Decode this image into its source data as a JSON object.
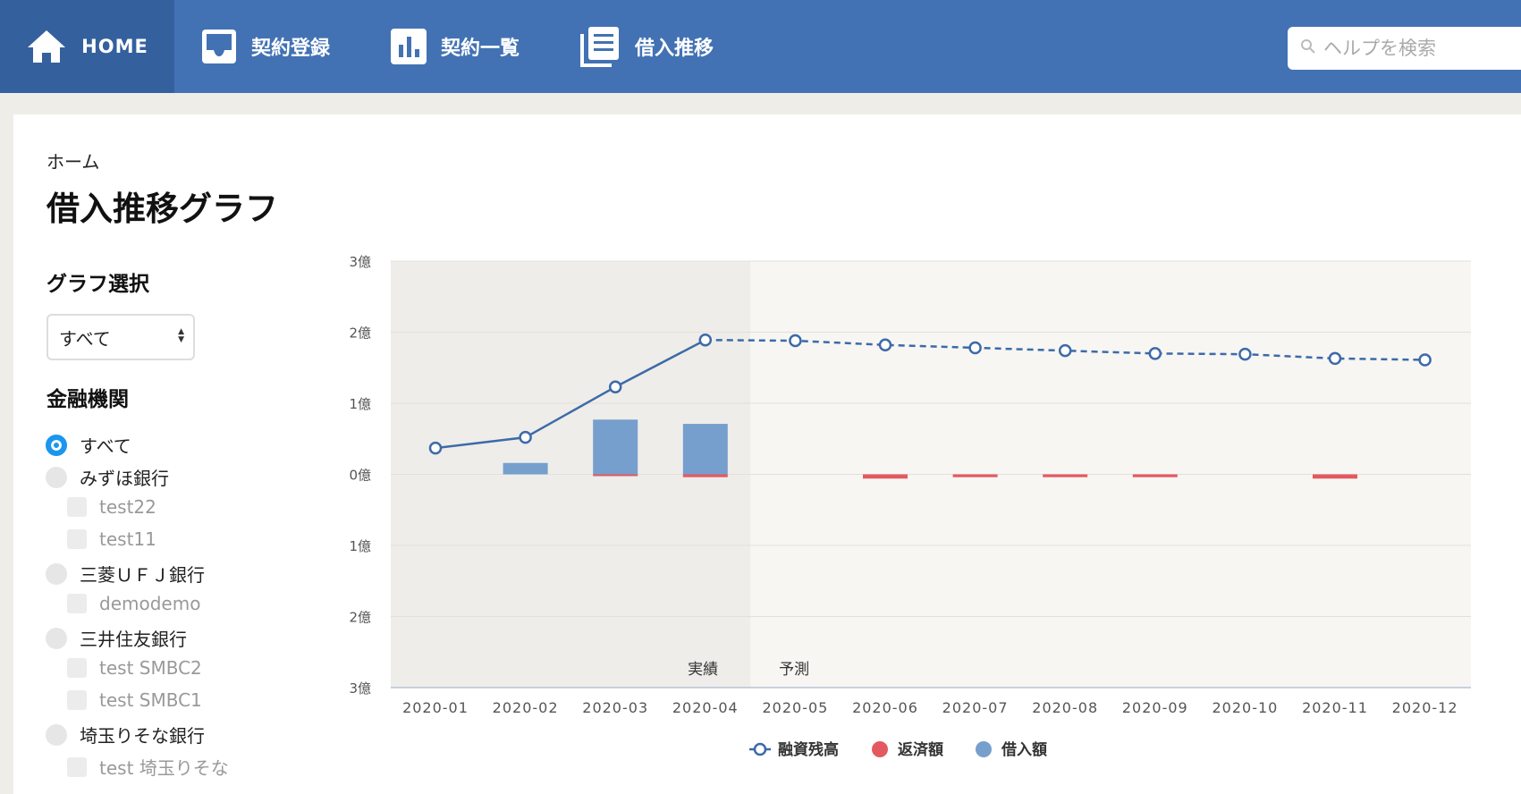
{
  "nav": {
    "items": [
      {
        "label": "HOME",
        "icon": "home-icon"
      },
      {
        "label": "契約登録",
        "icon": "inbox-icon"
      },
      {
        "label": "契約一覧",
        "icon": "bar-chart-icon"
      },
      {
        "label": "借入推移",
        "icon": "documents-icon"
      }
    ],
    "search_placeholder": "ヘルプを検索"
  },
  "breadcrumb": "ホーム",
  "page_title": "借入推移グラフ",
  "sidebar": {
    "graph_select_title": "グラフ選択",
    "graph_select_value": "すべて",
    "institutions_title": "金融機関",
    "institutions": [
      {
        "label": "すべて",
        "type": "radio",
        "checked": true
      },
      {
        "label": "みずほ銀行",
        "type": "radio"
      },
      {
        "label": "test22",
        "type": "checkbox"
      },
      {
        "label": "test11",
        "type": "checkbox"
      },
      {
        "label": "三菱ＵＦＪ銀行",
        "type": "radio"
      },
      {
        "label": "demodemo",
        "type": "checkbox"
      },
      {
        "label": "三井住友銀行",
        "type": "radio"
      },
      {
        "label": "test SMBC2",
        "type": "checkbox"
      },
      {
        "label": "test SMBC1",
        "type": "checkbox"
      },
      {
        "label": "埼玉りそな銀行",
        "type": "radio"
      },
      {
        "label": "test 埼玉りそな",
        "type": "checkbox"
      }
    ]
  },
  "chart_data": {
    "type": "bar+line",
    "categories": [
      "2020-01",
      "2020-02",
      "2020-03",
      "2020-04",
      "2020-05",
      "2020-06",
      "2020-07",
      "2020-08",
      "2020-09",
      "2020-10",
      "2020-11",
      "2020-12"
    ],
    "ylim": [
      -3,
      3
    ],
    "y_ticks": [
      3,
      2,
      1,
      0,
      -1,
      -2,
      -3
    ],
    "y_tick_labels": [
      "3億",
      "2億",
      "1億",
      "0億",
      "1億",
      "2億",
      "3億"
    ],
    "y_unit": "億",
    "grid": true,
    "legend_position": "bottom-center",
    "regions": [
      {
        "label": "実績",
        "from": "2020-01",
        "to": "2020-04"
      },
      {
        "label": "予測",
        "from": "2020-05",
        "to": "2020-12"
      }
    ],
    "series": [
      {
        "name": "融資残高",
        "kind": "line",
        "color": "#3d6aa8",
        "actual_through": "2020-04",
        "values": [
          0.37,
          0.52,
          1.23,
          1.89,
          1.88,
          1.82,
          1.78,
          1.74,
          1.7,
          1.69,
          1.63,
          1.61
        ]
      },
      {
        "name": "返済額",
        "kind": "bar",
        "color": "#e4595f",
        "values": [
          0,
          0,
          -0.02,
          -0.04,
          0,
          -0.06,
          -0.04,
          -0.04,
          -0.04,
          0,
          -0.06,
          0
        ]
      },
      {
        "name": "借入額",
        "kind": "bar",
        "color": "#769fcd",
        "values": [
          0,
          0.16,
          0.77,
          0.71,
          0,
          0,
          0,
          0,
          0,
          0,
          0,
          0
        ]
      }
    ]
  }
}
